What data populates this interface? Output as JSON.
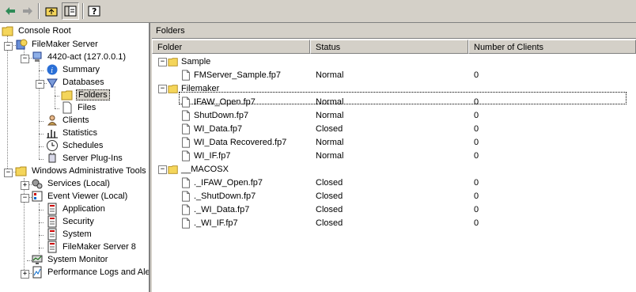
{
  "tree": {
    "console_root": "Console Root",
    "filemaker_server": "FileMaker Server",
    "host": "4420-act (127.0.0.1)",
    "summary": "Summary",
    "databases": "Databases",
    "folders": "Folders",
    "files": "Files",
    "clients": "Clients",
    "statistics": "Statistics",
    "schedules": "Schedules",
    "server_plugins": "Server Plug-Ins",
    "windows_admin_tools": "Windows Administrative Tools",
    "services": "Services (Local)",
    "event_viewer": "Event Viewer (Local)",
    "application": "Application",
    "security": "Security",
    "system": "System",
    "filemaker_server_8": "FileMaker Server 8",
    "system_monitor": "System Monitor",
    "perf_logs": "Performance Logs and Ale"
  },
  "pane": {
    "title": "Folders",
    "columns": [
      "Folder",
      "Status",
      "Number of Clients"
    ]
  },
  "groups": [
    {
      "name": "Sample",
      "files": [
        {
          "name": "FMServer_Sample.fp7",
          "status": "Normal",
          "clients": "0"
        }
      ]
    },
    {
      "name": "Filemaker",
      "files": [
        {
          "name": "IFAW_Open.fp7",
          "status": "Normal",
          "clients": "0"
        },
        {
          "name": "ShutDown.fp7",
          "status": "Normal",
          "clients": "0"
        },
        {
          "name": "WI_Data.fp7",
          "status": "Closed",
          "clients": "0"
        },
        {
          "name": "WI_Data Recovered.fp7",
          "status": "Normal",
          "clients": "0"
        },
        {
          "name": "WI_IF.fp7",
          "status": "Normal",
          "clients": "0"
        }
      ]
    },
    {
      "name": "__MACOSX",
      "files": [
        {
          "name": "._IFAW_Open.fp7",
          "status": "Closed",
          "clients": "0"
        },
        {
          "name": "._ShutDown.fp7",
          "status": "Closed",
          "clients": "0"
        },
        {
          "name": "._WI_Data.fp7",
          "status": "Closed",
          "clients": "0"
        },
        {
          "name": "._WI_IF.fp7",
          "status": "Closed",
          "clients": "0"
        }
      ]
    }
  ],
  "colors": {
    "folder_yellow": "#f4d55a",
    "folder_edge": "#b08a1a",
    "back_arrow": "#2e8b57"
  }
}
